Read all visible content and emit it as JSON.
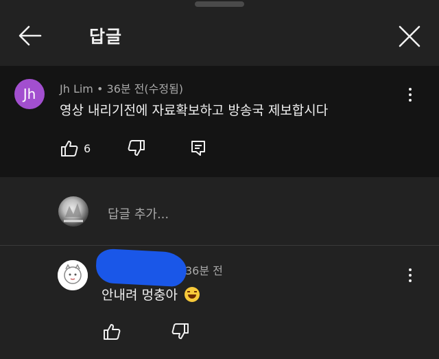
{
  "header": {
    "title": "답글",
    "back_icon": "arrow-left-icon",
    "close_icon": "close-icon"
  },
  "parent_comment": {
    "avatar_initials": "Jh",
    "avatar_color": "#a24fcf",
    "author": "Jh Lim",
    "separator": "•",
    "time": "36분 전(수정됨)",
    "text": "영상 내리기전에 자료확보하고 방송국 제보합시다",
    "like_count": "6",
    "icons": [
      "thumb-up-icon",
      "thumb-down-icon",
      "reply-icon",
      "more-vert-icon"
    ]
  },
  "add_reply": {
    "placeholder": "답글 추가..."
  },
  "reply": {
    "time": "36분 전",
    "text": "안내려 멍충아",
    "emoji": "grinning-sweat-emoji",
    "redaction_color": "#1a57e8",
    "icons": [
      "thumb-up-icon",
      "thumb-down-icon",
      "more-vert-icon"
    ]
  }
}
